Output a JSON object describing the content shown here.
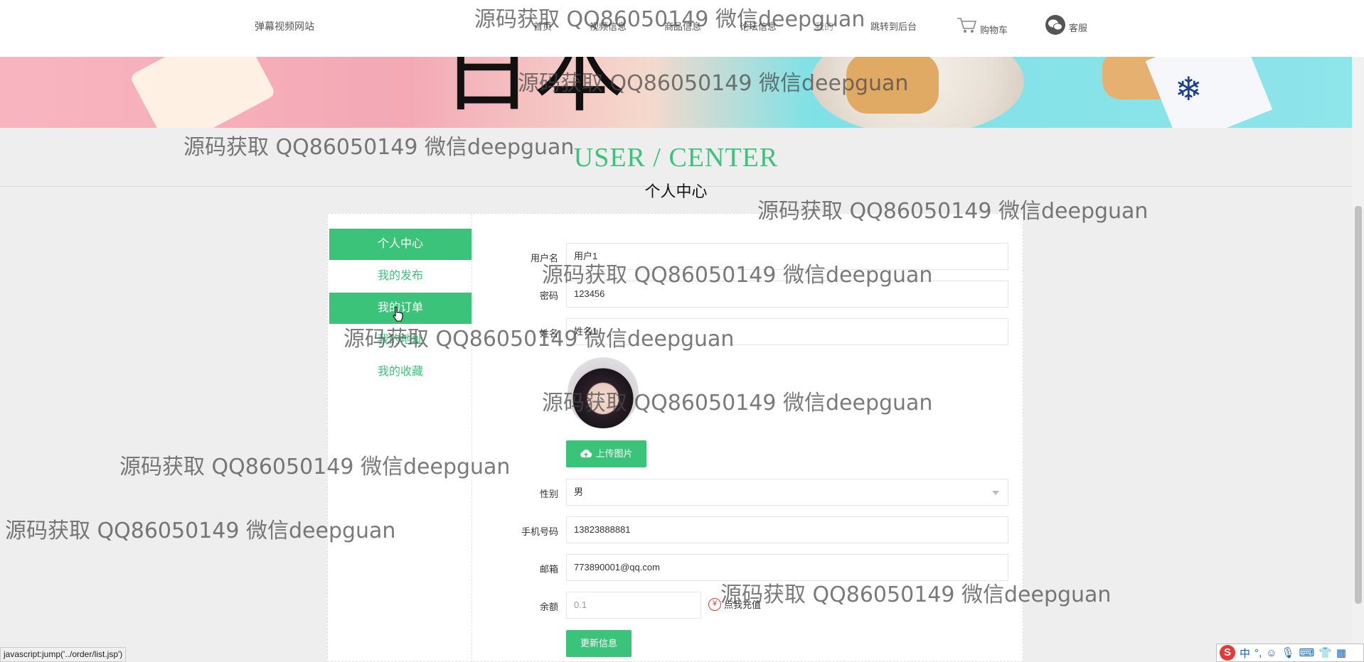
{
  "header": {
    "site_title": "弹幕视频网站",
    "nav": [
      "首页",
      "视频信息",
      "商品信息",
      "论坛信息",
      "我的",
      "跳转到后台"
    ],
    "cart_label": "购物车",
    "service_label": "客服"
  },
  "section": {
    "title_en": "USER / CENTER",
    "title_cn": "个人中心"
  },
  "sidebar": {
    "items": [
      {
        "label": "个人中心",
        "active": true
      },
      {
        "label": "我的发布",
        "active": false
      },
      {
        "label": "我的订单",
        "active": true
      },
      {
        "label": "我的地址",
        "active": false
      },
      {
        "label": "我的收藏",
        "active": false
      }
    ]
  },
  "form": {
    "username_label": "用户名",
    "username_value": "用户1",
    "password_label": "密码",
    "password_value": "123456",
    "name_label": "姓名",
    "name_value": "姓名1",
    "upload_label": "上传图片",
    "gender_label": "性别",
    "gender_value": "男",
    "phone_label": "手机号码",
    "phone_value": "13823888881",
    "email_label": "邮箱",
    "email_value": "773890001@qq.com",
    "balance_label": "余额",
    "balance_value": "0.1",
    "recharge_label": "点我充值",
    "update_label": "更新信息"
  },
  "watermark": "源码获取 QQ86050149 微信deepguan",
  "status_bar": "javascript:jump('../order/list.jsp')",
  "ime": {
    "lang": "中"
  },
  "colors": {
    "accent": "#3cc37a",
    "background": "#eeeeee",
    "recharge_icon": "#e53935"
  }
}
